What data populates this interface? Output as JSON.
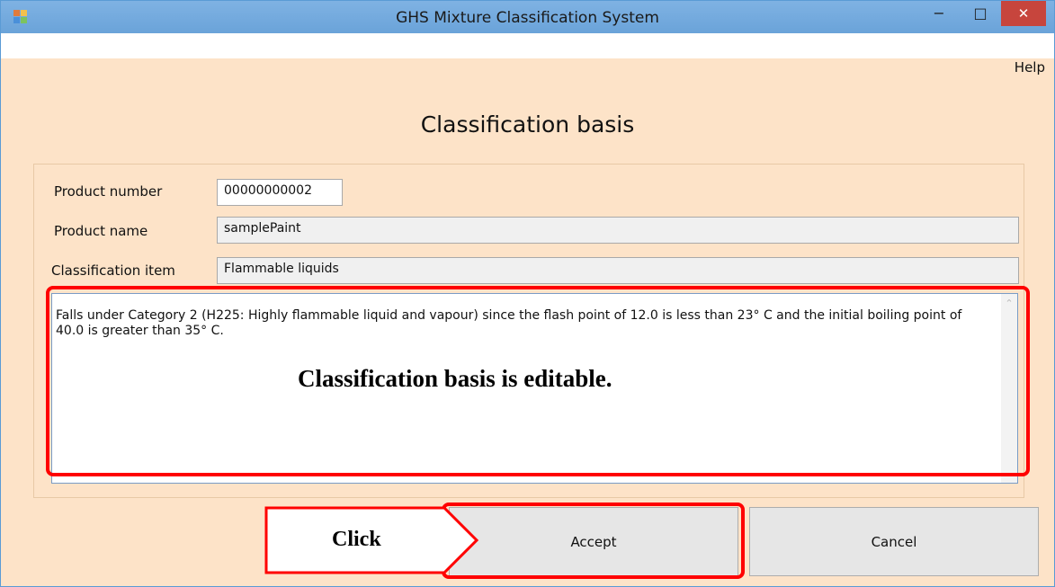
{
  "window": {
    "title": "GHS Mixture Classification System",
    "controls": {
      "minimize": "−",
      "maximize": "□",
      "close": "✕"
    }
  },
  "menu": {
    "help": "Help"
  },
  "heading": "Classification basis",
  "form": {
    "product_number_label": "Product number",
    "product_number_value": "00000000002",
    "product_name_label": "Product name",
    "product_name_value": "samplePaint",
    "classification_item_label": "Classification item",
    "classification_item_value": "Flammable liquids",
    "basis_text": "Falls under Category 2 (H225: Highly flammable liquid and vapour) since the flash point of 12.0 is less than 23° C and the initial boiling point of 40.0 is greater than 35° C."
  },
  "annotations": {
    "editable_note": "Classification basis is editable.",
    "click_note": "Click"
  },
  "buttons": {
    "accept": "Accept",
    "cancel": "Cancel"
  },
  "colors": {
    "annotation": "#ff0000",
    "titlebar": "#6fa8dc",
    "background": "#fde3c8"
  },
  "icons": {
    "app": "app-icon",
    "scroll_up": "scroll-up-icon",
    "scroll_down": "scroll-down-icon"
  }
}
